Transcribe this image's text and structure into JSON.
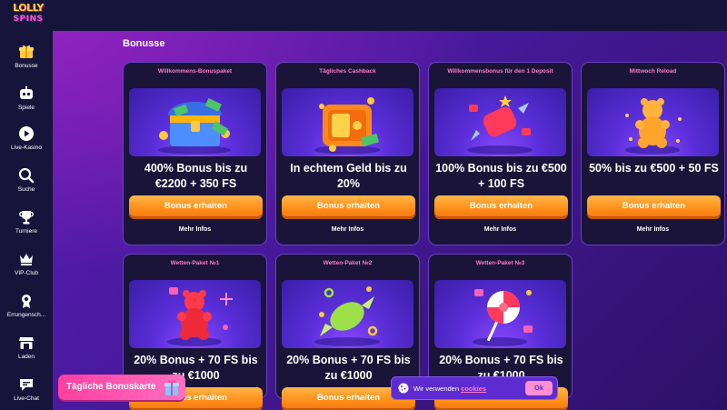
{
  "brand": {
    "line1": "LOLLY",
    "line2": "SPINS"
  },
  "sidebar": {
    "items": [
      {
        "label": "Bonusse",
        "icon": "gift-icon",
        "active": true
      },
      {
        "label": "Spiele",
        "icon": "gamepad-icon"
      },
      {
        "label": "Live-Kasino",
        "icon": "play-icon"
      },
      {
        "label": "Suche",
        "icon": "search-icon"
      },
      {
        "label": "Turniere",
        "icon": "trophy-icon"
      },
      {
        "label": "VIP-Club",
        "icon": "crown-icon"
      },
      {
        "label": "Errungensch...",
        "icon": "medal-icon"
      },
      {
        "label": "Laden",
        "icon": "shop-icon"
      },
      {
        "label": "Live-Chat",
        "icon": "chat-icon"
      }
    ]
  },
  "page": {
    "title": "Bonusse"
  },
  "cards": [
    {
      "title": "Willkommens-Bonuspaket",
      "headline": "400% Bonus bis zu €2200 + 350 FS",
      "button": "Bonus erhalten",
      "more": "Mehr Infos",
      "art": "treasure-chest-illustration"
    },
    {
      "title": "Tägliches Cashback",
      "headline": "In echtem Geld bis zu 20%",
      "button": "Bonus erhalten",
      "more": "Mehr Infos",
      "art": "safe-illustration"
    },
    {
      "title": "Willkommensbonus für den 1 Deposit",
      "headline": "100% Bonus bis zu €500 + 100 FS",
      "button": "Bonus erhalten",
      "more": "Mehr Infos",
      "art": "candy-illustration"
    },
    {
      "title": "Mittwoch Reload",
      "headline": "50% bis zu €500 + 50 FS",
      "button": "Bonus erhalten",
      "more": "Mehr Infos",
      "art": "gummy-bear-illustration"
    },
    {
      "title": "Wetten-Paket №1",
      "headline": "20% Bonus + 70 FS bis zu €1000",
      "button": "Bonus erhalten",
      "art": "red-gummy-bear-illustration"
    },
    {
      "title": "Wetten-Paket №2",
      "headline": "20% Bonus + 70 FS bis zu €1000",
      "button": "Bonus erhalten",
      "art": "wrapped-candy-illustration"
    },
    {
      "title": "Wetten-Paket №3",
      "headline": "20% Bonus + 70 FS bis zu €1000",
      "button": "Bonus erhalten",
      "art": "lollipop-illustration"
    }
  ],
  "daily_card": {
    "label": "Tägliche Bonuskarte"
  },
  "cookie_bar": {
    "text": "Wir verwenden ",
    "link": "cookies",
    "ok": "Ok"
  },
  "colors": {
    "accent_orange": "#ff8f1a",
    "accent_pink": "#ff7bd0",
    "card_border": "#6b3ec7"
  }
}
